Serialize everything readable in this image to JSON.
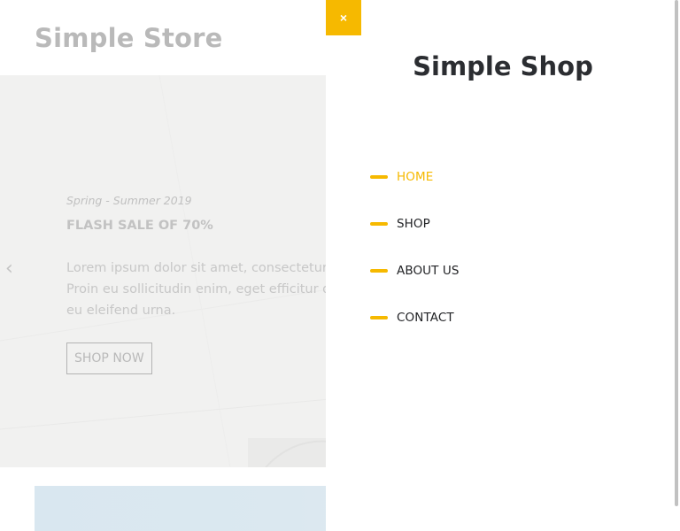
{
  "store": {
    "title": "Simple Store"
  },
  "hero": {
    "subtitle": "Spring - Summer 2019",
    "title": "FLASH SALE OF 70%",
    "text_lines": [
      "Lorem ipsum dolor sit amet, consectetur a",
      "Proin eu sollicitudin enim, eget efficitur q",
      "eu eleifend urna."
    ],
    "cta_label": "SHOP NOW",
    "prev_arrow": "‹"
  },
  "menu": {
    "close_label": "×",
    "title": "Simple Shop",
    "items": [
      {
        "label": "HOME",
        "active": true
      },
      {
        "label": "SHOP",
        "active": false
      },
      {
        "label": "ABOUT US",
        "active": false
      },
      {
        "label": "CONTACT",
        "active": false
      }
    ]
  },
  "colors": {
    "accent": "#f6b900",
    "menu_title": "#2b2d31",
    "menu_text": "#222326"
  }
}
